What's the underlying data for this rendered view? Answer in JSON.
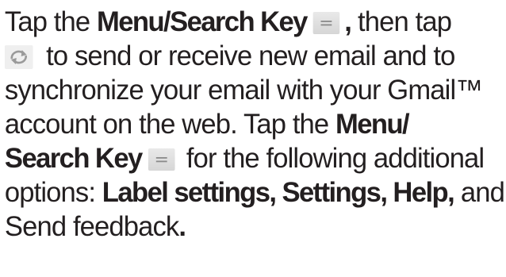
{
  "paragraph": {
    "l1": {
      "a": "Tap the ",
      "b": "Menu/Search Key",
      "c": ",",
      "d": " then tap"
    },
    "l2": {
      "a": " to send or receive new email and to"
    },
    "l3": {
      "a": "synchronize your email with your Gmail™"
    },
    "l4": {
      "a": "account on the web. Tap the ",
      "b": "Menu/"
    },
    "l5": {
      "a": "Search Key",
      "b": " for the following additional"
    },
    "l6": {
      "a": "options: ",
      "b": "Label settings, Settings, Help,",
      "c": " and"
    },
    "l7": {
      "a": "Send feedback",
      "b": "."
    }
  },
  "icons": {
    "menu_key": "menu-icon",
    "sync": "sync-icon"
  },
  "colors": {
    "text": "#231f20",
    "icon_bg": "#e0e0e0",
    "icon_fg": "#8a8a8a"
  }
}
